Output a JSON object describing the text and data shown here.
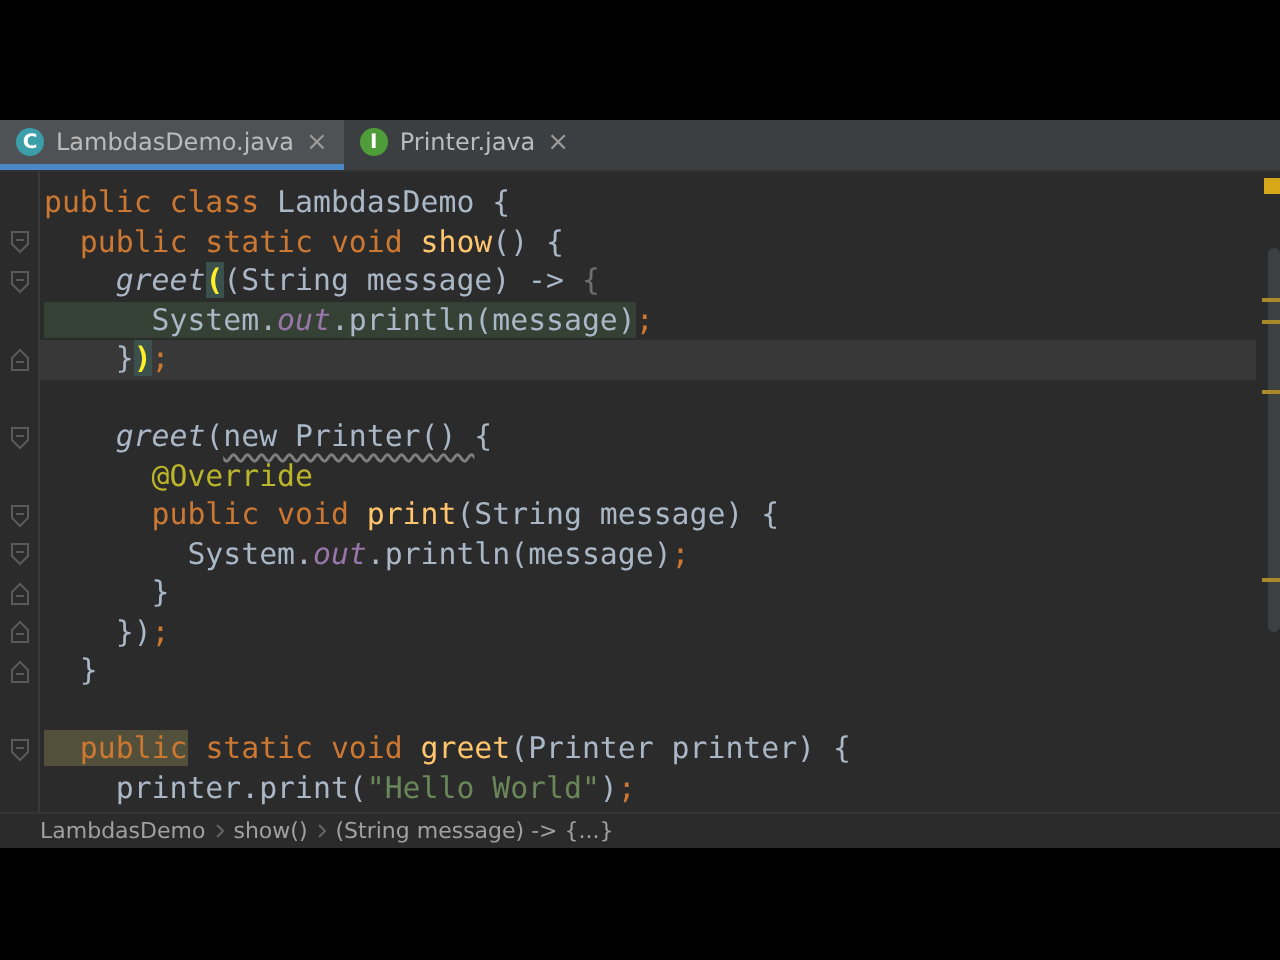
{
  "tabs": [
    {
      "label": "LambdasDemo.java",
      "icon_letter": "C",
      "color": "#3b9ea8",
      "selected": true,
      "close": "×"
    },
    {
      "label": "Printer.java",
      "icon_letter": "I",
      "color": "#4f9d3a",
      "selected": false,
      "close": "×"
    }
  ],
  "editor": {
    "warning": true,
    "lines": [
      {
        "kind": "plain",
        "current": false,
        "tokens": [
          {
            "kind": "kw",
            "text": "public class "
          },
          {
            "kind": "plain",
            "text": "LambdasDemo {"
          }
        ]
      },
      {
        "kind": "fold-open",
        "current": false,
        "tokens": [
          {
            "kind": "kw",
            "text": "  public static void "
          },
          {
            "kind": "fn",
            "text": "show"
          },
          {
            "kind": "plain",
            "text": "() {"
          }
        ]
      },
      {
        "kind": "fold-open",
        "current": false,
        "tokens": [
          {
            "kind": "call",
            "text": "    greet"
          },
          {
            "kind": "match",
            "text": "("
          },
          {
            "kind": "plain",
            "text": "(String message) -> "
          },
          {
            "kind": "dim",
            "text": "{"
          }
        ]
      },
      {
        "kind": "plain",
        "current": false,
        "tokens": [
          {
            "kind": "hl",
            "text": "      System."
          },
          {
            "kind": "hl-field",
            "text": "out"
          },
          {
            "kind": "hl",
            "text": ".println(message)"
          },
          {
            "kind": "semi",
            "text": ";"
          }
        ]
      },
      {
        "kind": "fold-close",
        "current": true,
        "tokens": [
          {
            "kind": "plain",
            "text": "    }"
          },
          {
            "kind": "match",
            "text": ")"
          },
          {
            "kind": "semi",
            "text": ";"
          }
        ]
      },
      {
        "kind": "plain",
        "current": false
      },
      {
        "kind": "fold-open",
        "current": false,
        "tokens": [
          {
            "kind": "call",
            "text": "    greet"
          },
          {
            "kind": "plain",
            "text": "("
          },
          {
            "kind": "warn",
            "text": "new Printer() "
          },
          {
            "kind": "plain",
            "text": "{"
          }
        ]
      },
      {
        "kind": "plain",
        "current": false,
        "tokens": [
          {
            "kind": "ann",
            "text": "      @Override"
          }
        ]
      },
      {
        "kind": "fold-open",
        "current": false,
        "tokens": [
          {
            "kind": "kw",
            "text": "      public void "
          },
          {
            "kind": "fn",
            "text": "print"
          },
          {
            "kind": "plain",
            "text": "(String message) {"
          }
        ]
      },
      {
        "kind": "fold-open",
        "current": false,
        "tokens": [
          {
            "kind": "plain",
            "text": "        System."
          },
          {
            "kind": "field",
            "text": "out"
          },
          {
            "kind": "plain",
            "text": ".println(message)"
          },
          {
            "kind": "semi",
            "text": ";"
          }
        ]
      },
      {
        "kind": "fold-close",
        "current": false,
        "tokens": [
          {
            "kind": "plain",
            "text": "      }"
          }
        ]
      },
      {
        "kind": "fold-close",
        "current": false,
        "tokens": [
          {
            "kind": "plain",
            "text": "    })"
          },
          {
            "kind": "semi",
            "text": ";"
          }
        ]
      },
      {
        "kind": "fold-close",
        "current": false,
        "tokens": [
          {
            "kind": "plain",
            "text": "  }"
          }
        ]
      },
      {
        "kind": "plain",
        "current": false
      },
      {
        "kind": "fold-open",
        "current": false,
        "tokens": [
          {
            "kind": "usage",
            "text": "  public"
          },
          {
            "kind": "kw",
            "text": " static void "
          },
          {
            "kind": "fn",
            "text": "greet"
          },
          {
            "kind": "plain",
            "text": "(Printer printer) {"
          }
        ]
      },
      {
        "kind": "plain",
        "current": false,
        "tokens": [
          {
            "kind": "plain",
            "text": "    printer.print("
          },
          {
            "kind": "str",
            "text": "\"Hello World\""
          },
          {
            "kind": "plain",
            "text": ")"
          },
          {
            "kind": "semi",
            "text": ";"
          }
        ]
      }
    ]
  },
  "breadcrumbs": [
    "LambdasDemo",
    "show()",
    "(String message) -> {...}"
  ]
}
